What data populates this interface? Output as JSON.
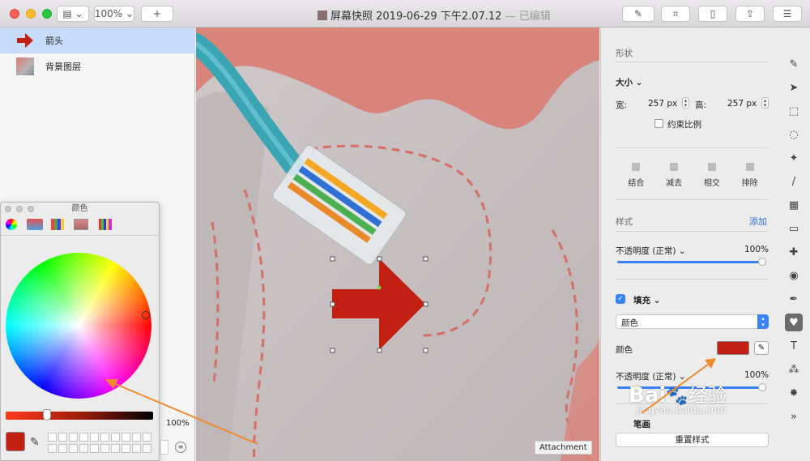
{
  "window": {
    "title": "屏幕快照 2019-06-29 下午2.07.12",
    "status": "— 已编辑",
    "zoom": "100%",
    "add_label": "+"
  },
  "layers": [
    {
      "label": "箭头"
    },
    {
      "label": "背景图层"
    }
  ],
  "color_panel": {
    "title": "颜色",
    "opacity_value": "100%"
  },
  "canvas": {
    "attachment_label": "Attachment"
  },
  "inspector": {
    "shape_heading": "形状",
    "size_label": "大小",
    "width_label": "宽:",
    "width_value": "257 px",
    "height_label": "高:",
    "height_value": "257 px",
    "constrain_label": "约束比例",
    "combine_buttons": [
      "结合",
      "减去",
      "相交",
      "排除"
    ],
    "style_heading": "样式",
    "add_label": "添加",
    "opacity_label": "不透明度 (正常)",
    "opacity_value": "100%",
    "fill_label": "填充",
    "fill_type": "颜色",
    "color_label": "颜色",
    "fill_color": "#c22012",
    "fill_opacity_label": "不透明度 (正常)",
    "fill_opacity_value": "100%",
    "stroke_label": "笔画",
    "reset_label": "重置样式"
  },
  "watermark": {
    "brand": "Bai",
    "brand_cn": "经验",
    "url": "jingyan.baidu.com"
  },
  "tools": [
    "style-icon",
    "pointer-icon",
    "marquee-icon",
    "lasso-icon",
    "magic-wand-icon",
    "brush-icon",
    "fill-icon",
    "eraser-icon",
    "heal-icon",
    "clone-icon",
    "pen-icon",
    "shape-icon",
    "text-icon",
    "effects-icon",
    "sparkle-icon",
    "more-icon"
  ],
  "tool_glyphs": [
    "✎",
    "➤",
    "⬚",
    "◌",
    "✦",
    "/",
    "▦",
    "▭",
    "✚",
    "◉",
    "✒",
    "♥",
    "T",
    "⁂",
    "✸",
    "»"
  ],
  "active_tool": 11,
  "colors": {
    "accent": "#3b82f6",
    "arrow": "#c22012",
    "annotation": "#f08a30"
  }
}
